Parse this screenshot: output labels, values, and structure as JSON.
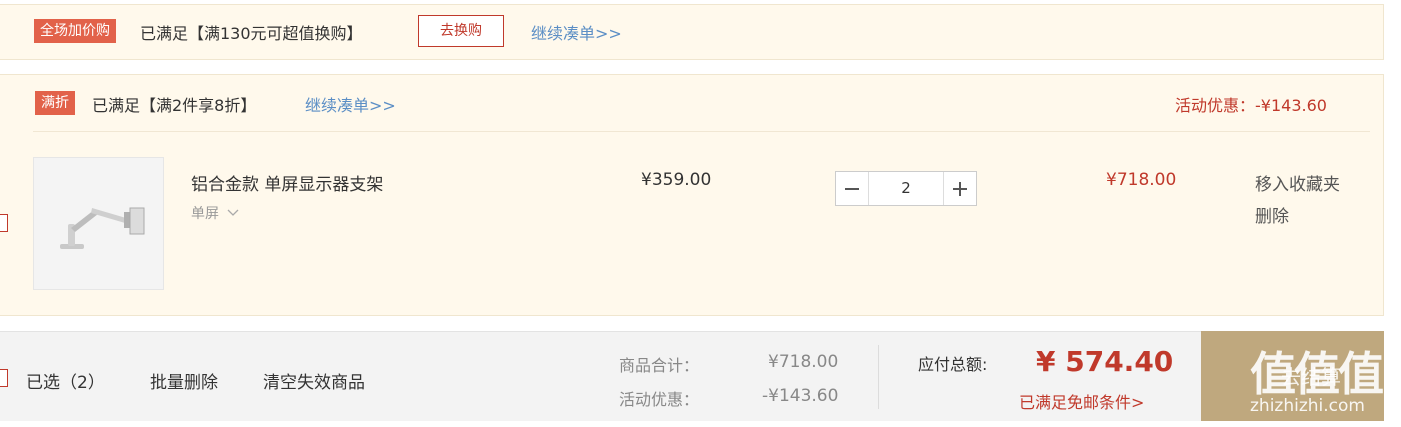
{
  "promo_bar": {
    "tag": "全场加价购",
    "status": "已满足【满130元可超值换购】",
    "action_button": "去换购",
    "continue_link": "继续凑单>>"
  },
  "discount_group": {
    "tag": "满折",
    "status": "已满足【满2件享8折】",
    "continue_link": "继续凑单>>",
    "discount_label": "活动优惠：-¥143.60"
  },
  "item": {
    "title": "铝合金款 单屏显示器支架",
    "variant": "单屏",
    "unit_price": "¥359.00",
    "quantity": "2",
    "subtotal": "¥718.00",
    "actions": {
      "move_to_favorites": "移入收藏夹",
      "delete": "删除"
    }
  },
  "summary": {
    "selected": "已选（2）",
    "batch_delete": "批量删除",
    "clear_invalid": "清空失效商品",
    "goods_total_label": "商品合计：",
    "goods_total_value": "¥718.00",
    "discount_label": "活动优惠：",
    "discount_value": "-¥143.60",
    "payable_label": "应付总额:",
    "payable_value": "¥ 574.40",
    "free_shipping": "已满足免邮条件>",
    "settle_button": "去结算"
  },
  "watermark": {
    "brand": "值值值",
    "domain": "zhizhizhi.com"
  },
  "colors": {
    "accent_red": "#c0392b",
    "tag_orange": "#e2624a",
    "link_blue": "#5b8ec5",
    "panel_bg": "#fff9ec",
    "settle_bg": "#bfa87e"
  }
}
